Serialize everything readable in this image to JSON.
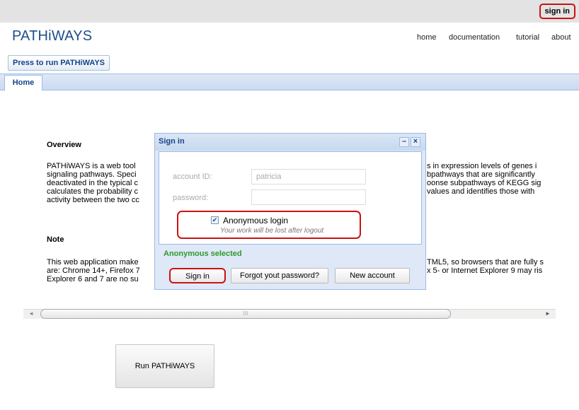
{
  "topbar": {
    "sign_in_label": "sign in"
  },
  "app": {
    "title": "PATHiWAYS"
  },
  "nav": {
    "home": "home",
    "documentation": "documentation",
    "tutorial": "tutorial",
    "about": "about"
  },
  "toolbar": {
    "run_label": "Press to run PATHiWAYS"
  },
  "tabs": {
    "home": "Home"
  },
  "overview": {
    "heading": "Overview",
    "lines": [
      "PATHiWAYS is a web tool",
      "signaling pathways. Speci",
      "deactivated in the typical c",
      "calculates the probability c",
      "activity between the two cc"
    ],
    "lines_right": [
      "s in expression levels of genes i",
      "bpathways that are significantly",
      "oonse subpathways of KEGG sig",
      "values and identifies those with",
      ""
    ]
  },
  "note": {
    "heading": "Note",
    "lines": [
      "This web application make",
      "are: Chrome 14+, Firefox 7",
      "Explorer 6 and 7 are no su"
    ],
    "lines_right": [
      "TML5, so browsers that are fully s",
      "x 5- or Internet Explorer 9 may ris",
      ""
    ]
  },
  "scrollbar": {
    "thumb_grip": "III",
    "left_arrow": "◄",
    "right_arrow": "►"
  },
  "run_button": {
    "label": "Run PATHiWAYS"
  },
  "dialog": {
    "title": "Sign in",
    "minimize": "–",
    "close": "×",
    "account_label": "account ID:",
    "account_value": "patricia",
    "password_label": "password:",
    "password_value": "",
    "anonymous_label": "Anonymous login",
    "anonymous_checked": true,
    "anonymous_note": "Your work will be lost after logout",
    "status": "Anonymous selected",
    "status_color": "#2c9a2c",
    "buttons": {
      "sign_in": "Sign in",
      "forgot": "Forgot yout password?",
      "new_account": "New account"
    }
  },
  "colors": {
    "accent": "#15428b",
    "highlight_outline": "#cc1111"
  }
}
